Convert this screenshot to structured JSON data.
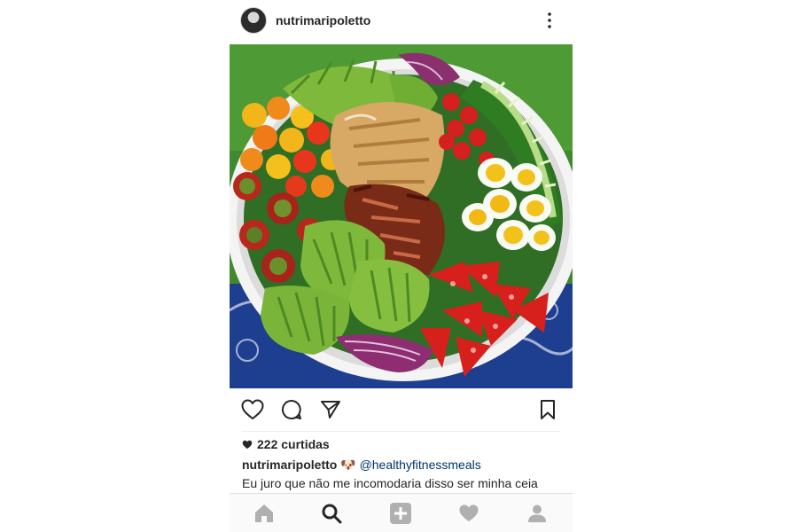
{
  "post": {
    "username": "nutrimaripoletto",
    "likes_label": "222 curtidas",
    "caption_username": "nutrimaripoletto",
    "caption_emoji": "🐶",
    "caption_mention": "@healthyfitnessmeals",
    "caption_text": "Eu juro que não me incomodaria disso ser minha ceia"
  },
  "icons": {
    "more": "more-vertical-icon",
    "like": "heart-outline-icon",
    "comment": "comment-icon",
    "share": "send-icon",
    "save": "bookmark-icon",
    "likes_heart": "heart-filled-icon",
    "nav_home": "home-icon",
    "nav_search": "search-icon",
    "nav_add": "add-post-icon",
    "nav_activity": "heart-icon",
    "nav_profile": "profile-icon"
  },
  "colors": {
    "text": "#262626",
    "mention": "#003569",
    "nav_inactive": "#b0b0b0",
    "nav_active": "#262626"
  }
}
